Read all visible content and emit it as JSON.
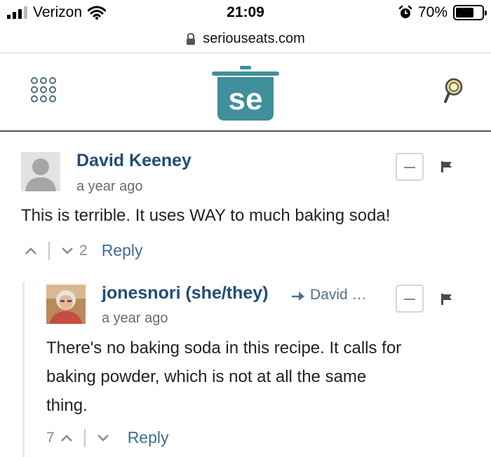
{
  "status_bar": {
    "carrier": "Verizon",
    "time": "21:09",
    "battery": "70%",
    "battery_level": 0.7
  },
  "browser": {
    "url": "seriouseats.com"
  },
  "site_header": {
    "logo_text": "se",
    "brand_color": "#3f8f9c"
  },
  "comments": [
    {
      "author": "David Keeney",
      "time": "a year ago",
      "text": "This is terrible. It uses WAY to much baking soda!",
      "downvotes": "2",
      "reply_label": "Reply"
    },
    {
      "author": "jonesnori (she/they)",
      "reply_to": "David …",
      "time": "a year ago",
      "text_lines": [
        "There's no baking soda in this recipe. It calls for",
        "baking powder, which is not at all the same",
        "thing."
      ],
      "upvotes": "7",
      "reply_label": "Reply"
    }
  ]
}
